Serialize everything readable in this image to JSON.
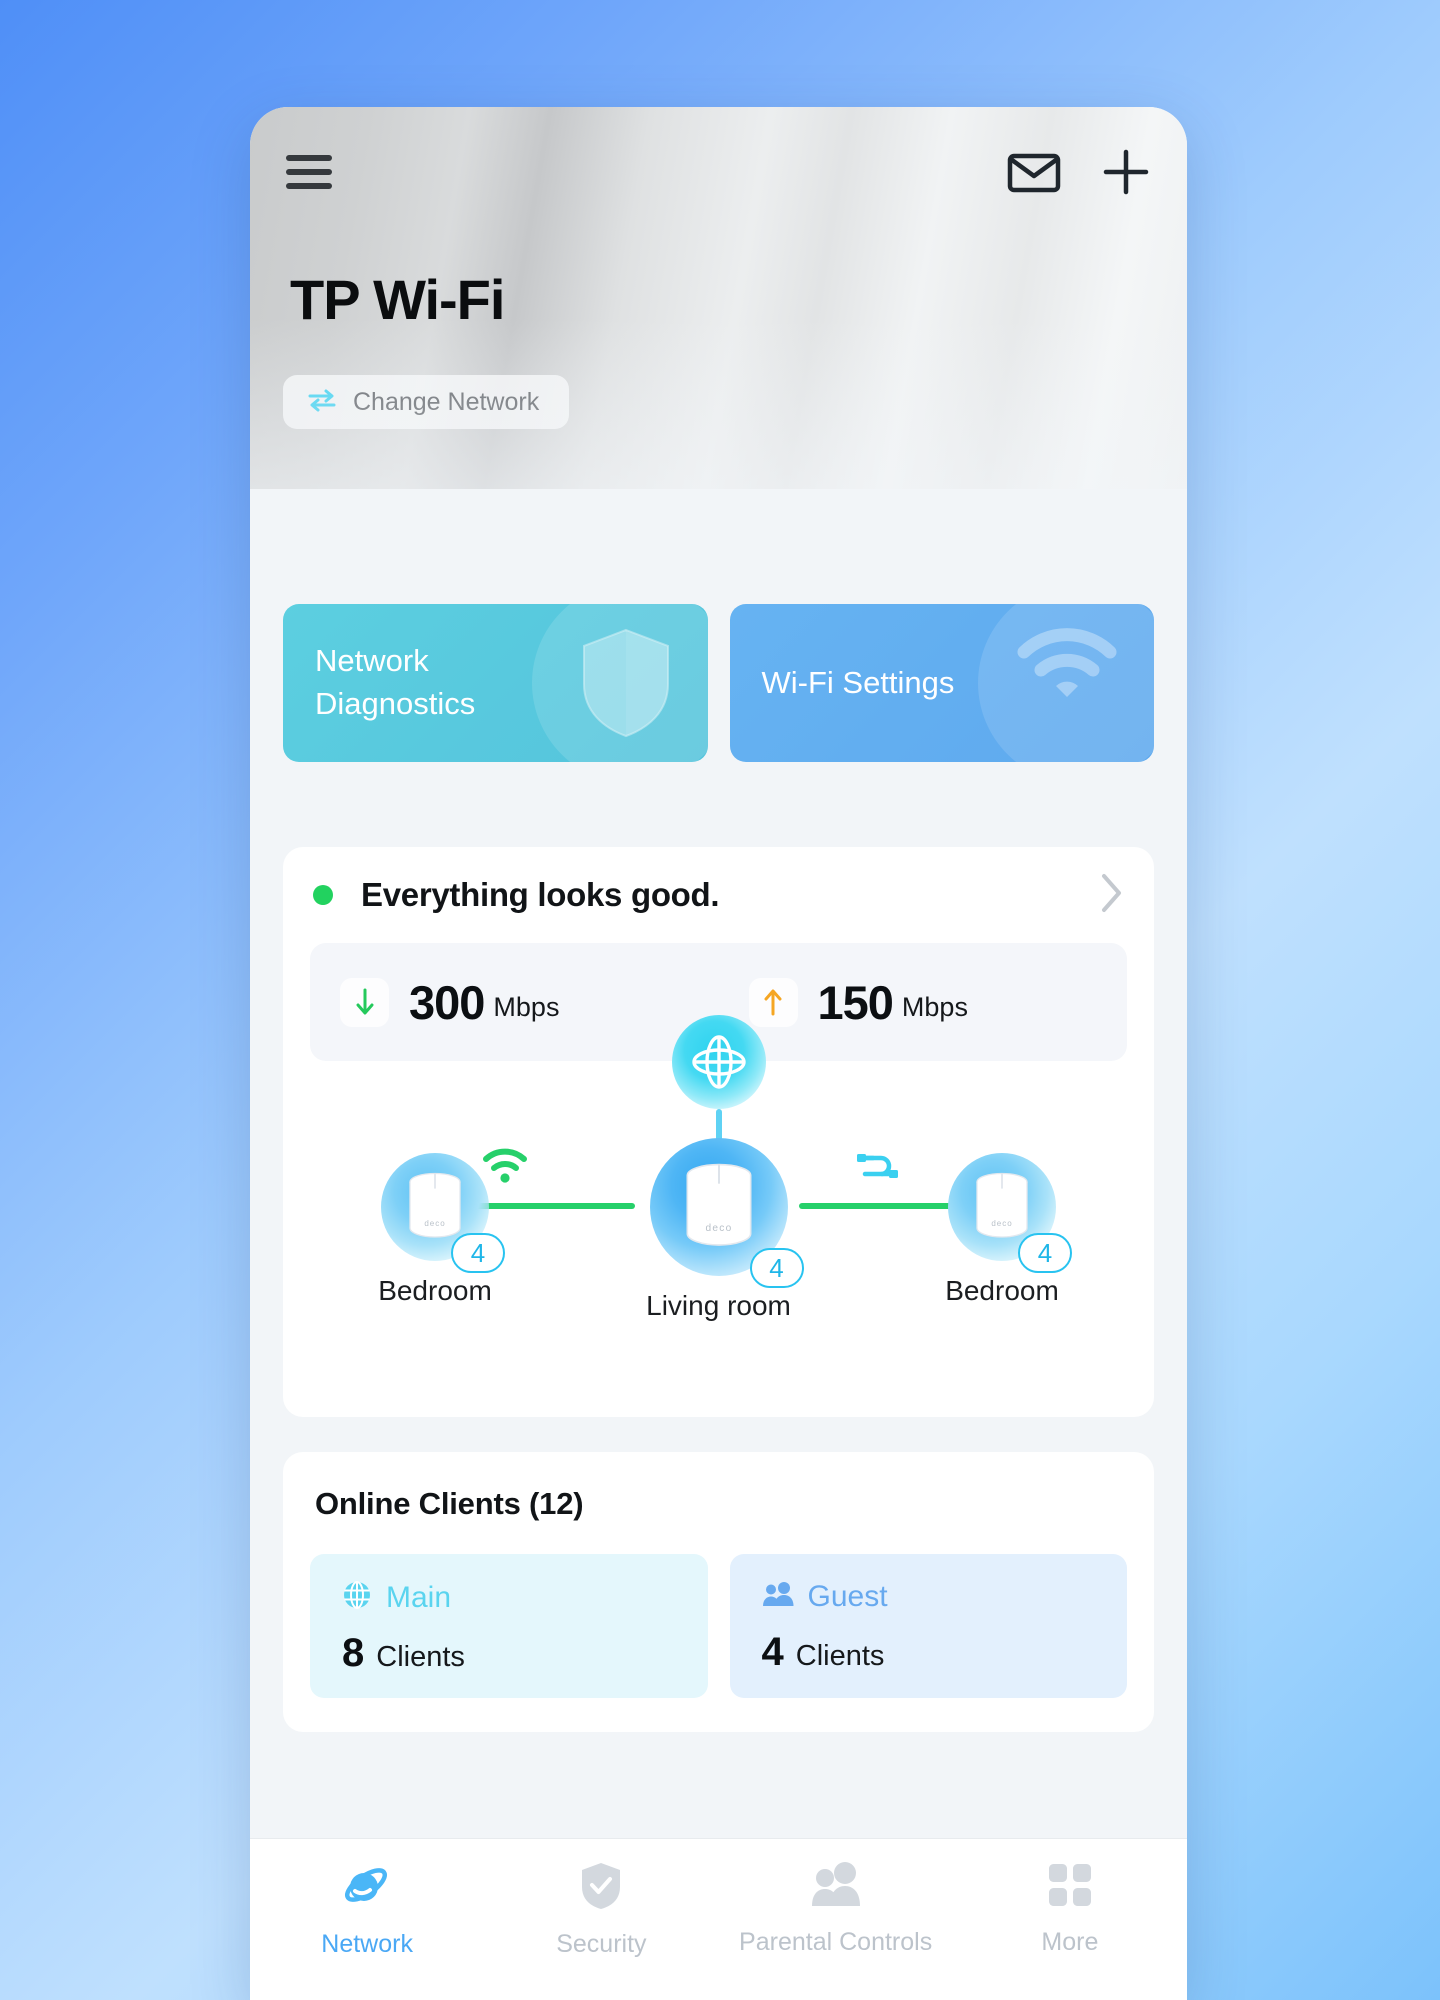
{
  "header": {
    "menu_icon": "hamburger-menu-icon",
    "mail_icon": "envelope-icon",
    "add_icon": "plus-icon",
    "title": "TP Wi-Fi",
    "change_network_label": "Change Network",
    "change_network_icon": "exchange-arrows-icon"
  },
  "quick_actions": [
    {
      "label": "Network Diagnostics",
      "icon": "shield-icon",
      "color": "#58c9de"
    },
    {
      "label": "Wi-Fi Settings",
      "icon": "wifi-icon",
      "color": "#62aef0"
    }
  ],
  "status": {
    "text": "Everything looks good.",
    "dot_color": "#22d25f",
    "chevron_icon": "chevron-right-icon",
    "download": {
      "icon": "arrow-down-icon",
      "icon_color": "#25c95c",
      "value": "300",
      "unit": "Mbps"
    },
    "upload": {
      "icon": "arrow-up-icon",
      "icon_color": "#f5a623",
      "value": "150",
      "unit": "Mbps"
    }
  },
  "topology": {
    "internet_icon": "globe-icon",
    "nodes": [
      {
        "label": "Bedroom",
        "badge": "4",
        "device_icon": "deco-router-icon"
      },
      {
        "label": "Living room",
        "badge": "4",
        "device_icon": "deco-router-icon"
      },
      {
        "label": "Bedroom",
        "badge": "4",
        "device_icon": "deco-router-icon"
      }
    ],
    "links": [
      {
        "from": "Bedroom",
        "to": "Living room",
        "type": "wireless",
        "icon": "wifi-signal-icon",
        "color": "#26d06a"
      },
      {
        "from": "Living room",
        "to": "Bedroom",
        "type": "wired",
        "icon": "ethernet-cable-icon",
        "color": "#26d06a"
      }
    ]
  },
  "clients": {
    "title": "Online Clients (12)",
    "tiles": [
      {
        "name": "Main",
        "icon": "globe-icon",
        "count": "8",
        "unit": "Clients",
        "accent": "#5ad4ef"
      },
      {
        "name": "Guest",
        "icon": "people-icon",
        "count": "4",
        "unit": "Clients",
        "accent": "#67a9ef"
      }
    ]
  },
  "tabbar": {
    "items": [
      {
        "label": "Network",
        "icon": "planet-orbit-icon",
        "active": true
      },
      {
        "label": "Security",
        "icon": "shield-check-icon",
        "active": false
      },
      {
        "label": "Parental Controls",
        "icon": "people-icon",
        "active": false
      },
      {
        "label": "More",
        "icon": "grid-squares-icon",
        "active": false
      }
    ]
  }
}
